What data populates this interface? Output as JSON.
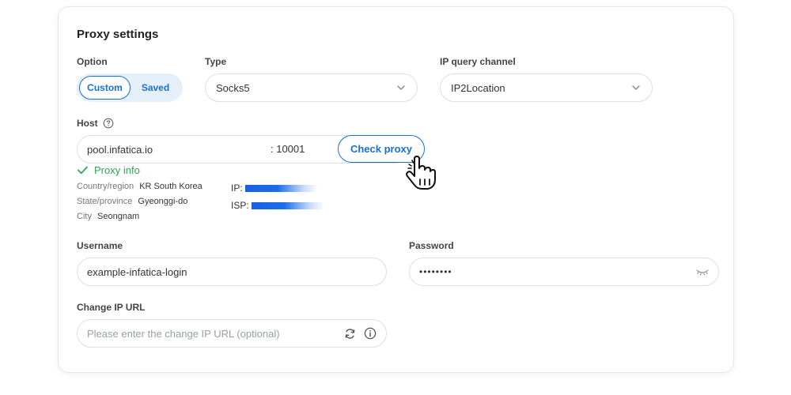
{
  "title": "Proxy settings",
  "option": {
    "label": "Option",
    "buttons": [
      "Custom",
      "Saved"
    ]
  },
  "type": {
    "label": "Type",
    "value": "Socks5"
  },
  "ip_query": {
    "label": "IP query channel",
    "value": "IP2Location"
  },
  "host": {
    "label": "Host",
    "host_value": "pool.infatica.io",
    "port_value": ": 10001",
    "check_label": "Check proxy",
    "help_icon": "question-circle-icon"
  },
  "proxy_info": {
    "label": "Proxy info",
    "country_label": "Country/region",
    "country_value": "KR South Korea",
    "state_label": "State/province",
    "state_value": "Gyeonggi-do",
    "city_label": "City",
    "city_value": "Seongnam",
    "ip_label": "IP:",
    "isp_label": "ISP:"
  },
  "username": {
    "label": "Username",
    "value": "example-infatica-login"
  },
  "password": {
    "label": "Password",
    "value": "••••••••"
  },
  "change_ip": {
    "label": "Change IP URL",
    "placeholder": "Please enter the change IP URL (optional)"
  },
  "colors": {
    "accent": "#1a6fd6",
    "success": "#2fa84f",
    "border": "#dcdfe4"
  }
}
